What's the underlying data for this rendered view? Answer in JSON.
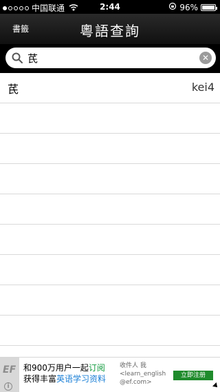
{
  "status_bar": {
    "carrier": "中国联通",
    "time": "2:44",
    "battery": "96%"
  },
  "nav": {
    "left_button": "書籤",
    "title": "粵語查詢"
  },
  "search": {
    "value": "芪"
  },
  "results": [
    {
      "word": "芪",
      "jyutping": "kei4"
    },
    {
      "word": "",
      "jyutping": ""
    },
    {
      "word": "",
      "jyutping": ""
    },
    {
      "word": "",
      "jyutping": ""
    },
    {
      "word": "",
      "jyutping": ""
    },
    {
      "word": "",
      "jyutping": ""
    },
    {
      "word": "",
      "jyutping": ""
    },
    {
      "word": "",
      "jyutping": ""
    },
    {
      "word": "",
      "jyutping": ""
    }
  ],
  "ad": {
    "logo": "EF",
    "line1_prefix": "和900万用户一起",
    "line1_highlight": "订阅",
    "line2_prefix": "获得丰富",
    "line2_highlight": "英语学习资料",
    "mail_line1": "收件人 我",
    "mail_line2": "<learn_english",
    "mail_line3": "@ef.com>",
    "cta": "立即注册"
  }
}
